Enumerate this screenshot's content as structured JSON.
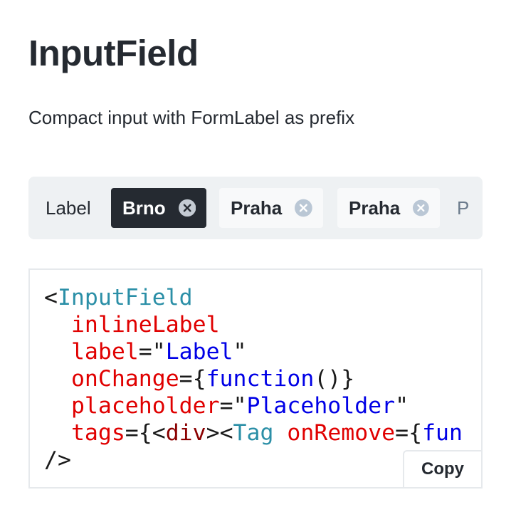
{
  "page": {
    "title": "InputField",
    "description": "Compact input with FormLabel as prefix"
  },
  "demo": {
    "label": "Label",
    "tags": [
      {
        "text": "Brno",
        "selected": true,
        "remove_icon": "circle-x-icon"
      },
      {
        "text": "Praha",
        "selected": false,
        "remove_icon": "circle-x-icon"
      },
      {
        "text": "Praha",
        "selected": false,
        "remove_icon": "circle-x-icon"
      }
    ],
    "placeholder_visible": "P"
  },
  "code": {
    "open_bracket": "<",
    "component": "InputField",
    "lines": [
      {
        "attr": "inlineLabel"
      },
      {
        "attr": "label",
        "eq": "=\"",
        "value": "Label",
        "close": "\""
      },
      {
        "attr": "onChange",
        "eq": "={",
        "value": "function",
        "close": "()}"
      },
      {
        "attr": "placeholder",
        "eq": "=\"",
        "value": "Placeholder",
        "close": "\""
      },
      {
        "attr": "tags",
        "eq": "={<",
        "elem": "div",
        "mid": "><",
        "tag": "Tag",
        "attr2": "onRemove",
        "eq2": "={",
        "value": "fun"
      }
    ],
    "close": "/>"
  },
  "copy_button": {
    "label": "Copy"
  },
  "colors": {
    "heading": "#252a31",
    "tag_selected_bg": "#252a31",
    "tag_plain_bg": "#f8f9fa",
    "demo_bg": "#eef1f3",
    "code_component": "#2b8fa7",
    "code_attribute": "#e00000",
    "code_value": "#0000e6",
    "code_element": "#8b0000"
  }
}
